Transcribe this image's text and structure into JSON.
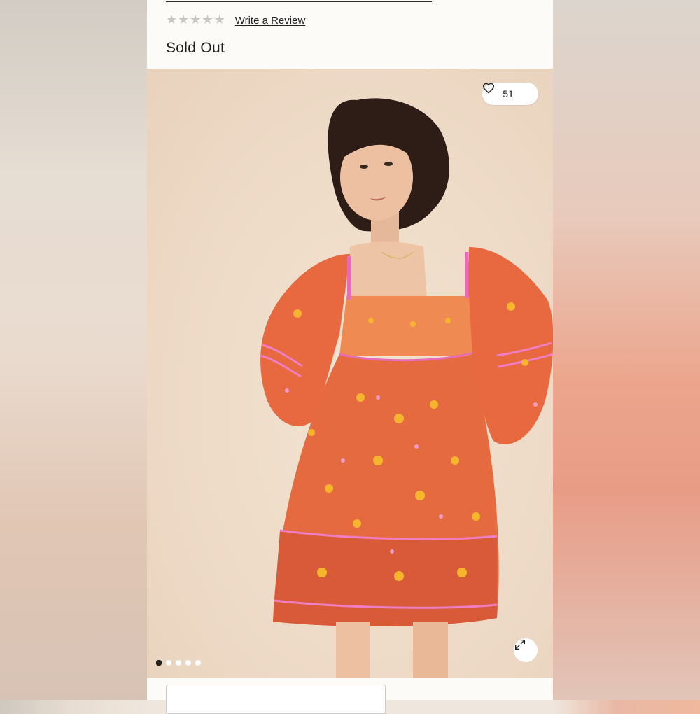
{
  "product": {
    "review_link": "Write a Review",
    "rating_stars": 5,
    "status": "Sold Out"
  },
  "gallery": {
    "like_count": "51",
    "active_slide": 1,
    "slide_count": 5
  },
  "icons": {
    "like": "heart-icon",
    "expand": "expand-icon"
  },
  "colors": {
    "panel": "#fcfbf8",
    "backdrop": "#efdcc9",
    "dress": "#e8683f",
    "accent_pink": "#e86bb8"
  }
}
